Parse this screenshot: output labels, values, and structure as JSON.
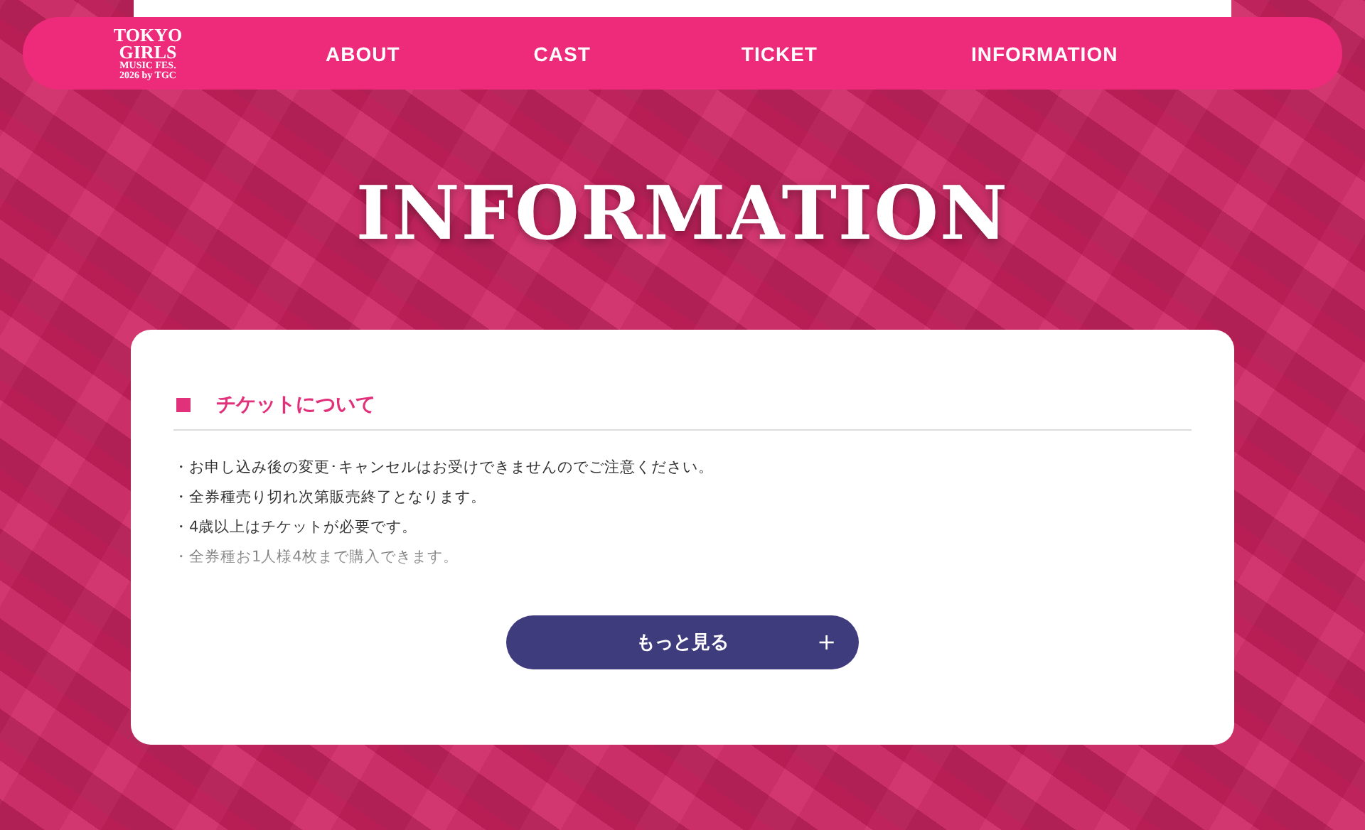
{
  "header": {
    "logo": [
      "TOKYO",
      "GIRLS",
      "MUSIC FES.",
      "2026 by TGC"
    ],
    "nav": [
      {
        "label": "ABOUT"
      },
      {
        "label": "CAST"
      },
      {
        "label": "TICKET"
      },
      {
        "label": "INFORMATION"
      }
    ]
  },
  "page_title": "INFORMATION",
  "card": {
    "heading": "チケットについて",
    "items": [
      "・お申し込み後の変更･キャンセルはお受けできませんのでご注意ください。",
      "・全券種売り切れ次第販売終了となります。",
      "・4歳以上はチケットが必要です。",
      "・全券種お1人様4枚まで購入できます。"
    ],
    "more_button": {
      "label": "もっと見る",
      "icon": "+"
    }
  }
}
